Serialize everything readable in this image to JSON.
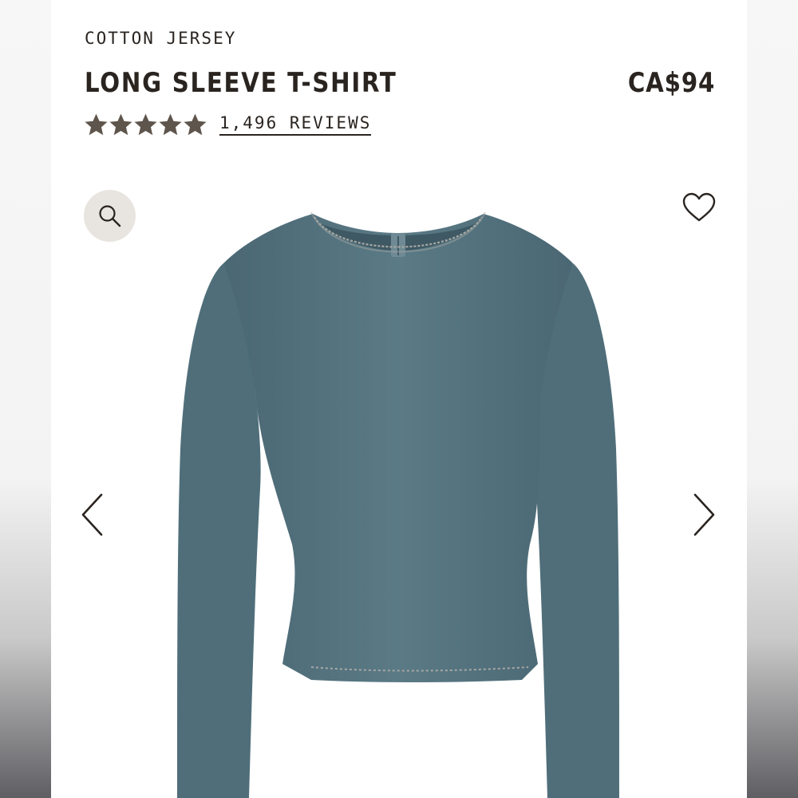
{
  "product": {
    "category": "COTTON JERSEY",
    "title": "LONG SLEEVE T-SHIRT",
    "price": "CA$94",
    "rating": 5,
    "rating_max": 5,
    "reviews_label": "1,496 REVIEWS"
  },
  "gallery": {
    "image_alt": "Long sleeve t-shirt",
    "zoom_icon": "search-icon",
    "wishlist_icon": "heart-icon",
    "prev_icon": "chevron-left-icon",
    "next_icon": "chevron-right-icon"
  },
  "colors": {
    "text": "#2a2420",
    "star": "#5e554c",
    "zoom_bg": "#e8e4df",
    "garment": "#557480",
    "stitching": "#a7a7a3"
  }
}
